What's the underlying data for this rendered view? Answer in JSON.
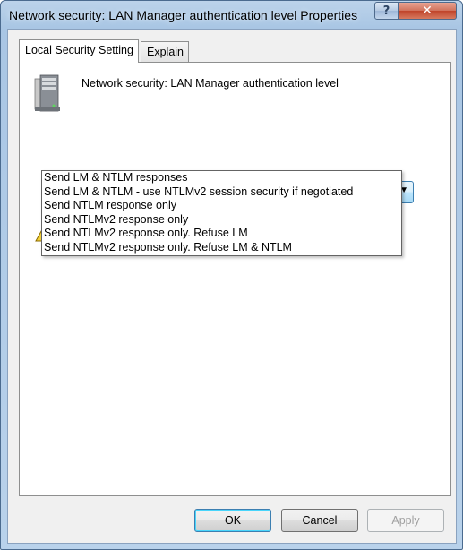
{
  "window": {
    "title": "Network security: LAN Manager authentication level Properties",
    "help_label": "?",
    "close_label": "✕"
  },
  "tabs": [
    {
      "label": "Local Security Setting",
      "selected": true
    },
    {
      "label": "Explain",
      "selected": false
    }
  ],
  "policy": {
    "name": "Network security: LAN Manager authentication level",
    "icon": "server-icon"
  },
  "combo": {
    "selected_value": "",
    "arrow": "▼",
    "options": [
      "Send LM & NTLM responses",
      "Send LM & NTLM - use NTLMv2 session security if negotiated",
      "Send NTLM response only",
      "Send NTLMv2 response only",
      "Send NTLMv2 response only. Refuse LM",
      "Send NTLMv2 response only. Refuse LM & NTLM"
    ]
  },
  "warning": {
    "icon": "warning-icon"
  },
  "buttons": {
    "ok": "OK",
    "cancel": "Cancel",
    "apply": "Apply"
  },
  "colors": {
    "accent": "#3c7fb1",
    "close": "#c0442a"
  }
}
